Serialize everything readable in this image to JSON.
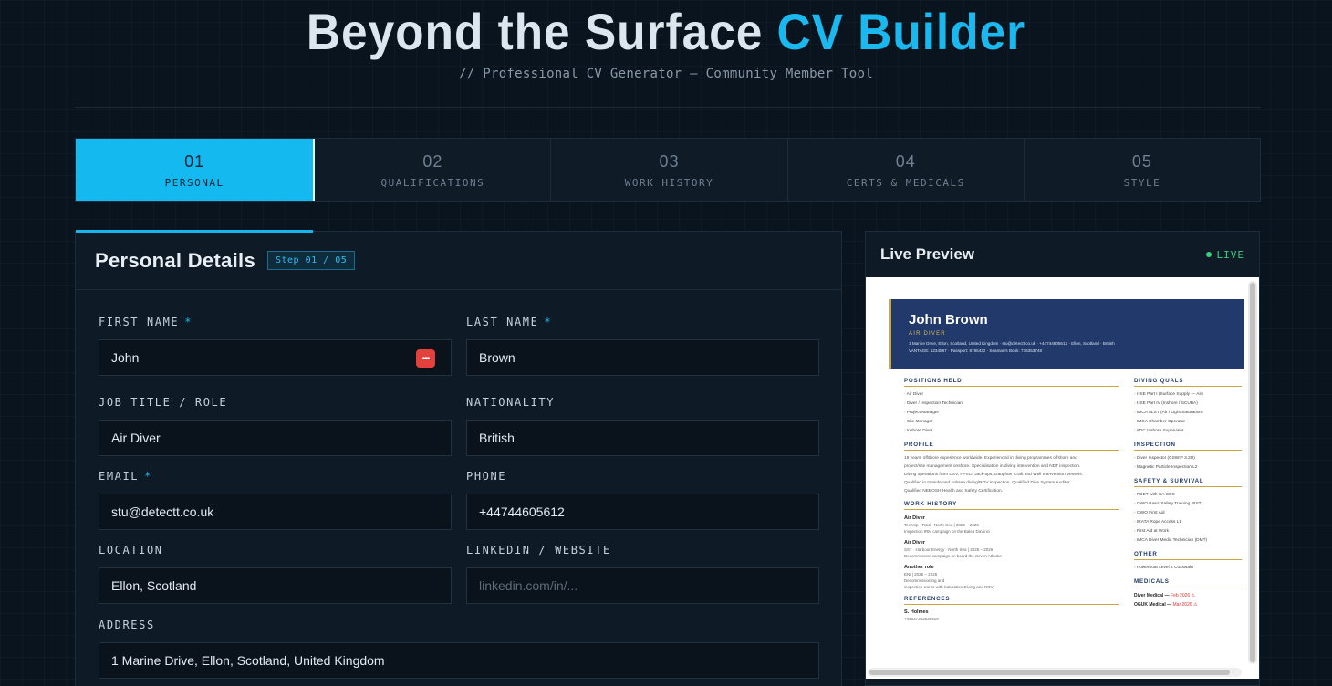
{
  "header": {
    "title_main": "Beyond the Surface ",
    "title_accent": "CV Builder",
    "subtitle": "// Professional CV Generator — Community Member Tool"
  },
  "steps": [
    {
      "num": "01",
      "label": "PERSONAL",
      "active": true
    },
    {
      "num": "02",
      "label": "QUALIFICATIONS",
      "active": false
    },
    {
      "num": "03",
      "label": "WORK HISTORY",
      "active": false
    },
    {
      "num": "04",
      "label": "CERTS & MEDICALS",
      "active": false
    },
    {
      "num": "05",
      "label": "STYLE",
      "active": false
    }
  ],
  "panel": {
    "title": "Personal Details",
    "step_badge": "Step 01 / 05",
    "required_mark": "*",
    "fields": {
      "first_name": {
        "label": "FIRST NAME",
        "value": "John"
      },
      "last_name": {
        "label": "LAST NAME",
        "value": "Brown"
      },
      "job_title": {
        "label": "JOB TITLE / ROLE",
        "value": "Air Diver"
      },
      "nationality": {
        "label": "NATIONALITY",
        "value": "British"
      },
      "email": {
        "label": "EMAIL",
        "value": "stu@detectt.co.uk"
      },
      "phone": {
        "label": "PHONE",
        "value": "+44744605612"
      },
      "location": {
        "label": "LOCATION",
        "value": "Ellon, Scotland"
      },
      "linkedin": {
        "label": "LINKEDIN / WEBSITE",
        "value": "",
        "placeholder": "linkedin.com/in/..."
      },
      "address": {
        "label": "ADDRESS",
        "value": "1 Marine Drive, Ellon, Scotland, United Kingdom"
      }
    }
  },
  "preview": {
    "title": "Live Preview",
    "live_label": "LIVE",
    "cv": {
      "name": "John Brown",
      "role": "AIR DIVER",
      "contact_line1": "1 Marine Drive, Ellon, Scotland, United Kingdom · stu@detectt.co.uk · +44744605612 · Ellon, Scotland · British",
      "contact_line2": "VANTAGE: 1234567 · Passport: 8765432 · Seaman's Book: 736353748",
      "positions_heading": "POSITIONS HELD",
      "positions": [
        "Air Diver",
        "Diver / Inspection Technician",
        "Project Manager",
        "Site Manager",
        "Inshore Diver"
      ],
      "profile_heading": "PROFILE",
      "profile_lines": [
        "18 years' offshore experience worldwide. Experienced in diving programmes offshore and",
        "project/site management onshore. Specialisation in diving intervention and NDT inspection.",
        "Diving operations from DSV, FPSO, Jack-ups, Daughter Craft and Well Intervention Vessels.",
        "Qualified in topside and subsea diving/ROV inspection. Qualified Dive System Auditor.",
        "Qualified NEBOSH Health and Safety Certification."
      ],
      "work_heading": "WORK HISTORY",
      "jobs": [
        {
          "title": "Air Diver",
          "meta1": "Technip · Total · North Sea | 2026 – 2026",
          "meta2": "Inspection IRM campaign on the Balea DaVinci"
        },
        {
          "title": "Air Diver",
          "meta1": "SS7 · Harbour Energy · North Sea | 2025 – 2026",
          "meta2": "Decommission campaign on board the Seven Atlantic"
        },
        {
          "title": "Another role",
          "meta1": "ENI | 2025 – 2025",
          "meta2": "Decommissioning and",
          "meta3": "inspection works with Saturation Diving and ROV"
        }
      ],
      "references_heading": "REFERENCES",
      "ref_name": "S. Holmes",
      "ref_phone": "+44537363636929",
      "diving_heading": "DIVING QUALS",
      "diving": [
        "HSE Part I (Surface Supply — Air)",
        "HSE Part IV (Inshore / SCUBA)",
        "IMCA ALST (Air / Light Saturation)",
        "IMCA Chamber Operator",
        "ADC Inshore Supervisor"
      ],
      "inspection_heading": "INSPECTION",
      "inspection": [
        "Diver Inspector (CSWIP 3.2U)",
        "Magnetic Particle Inspection L2"
      ],
      "safety_heading": "SAFETY & SURVIVAL",
      "safety": [
        "FOET with CA-EBS",
        "GWO Basic Safety Training (BST)",
        "GWO First Aid",
        "IRATA Rope Access L1",
        "First Aid at Work",
        "IMCA Diver Medic Technician (DMT)"
      ],
      "other_heading": "OTHER",
      "other": [
        "Powerboat Level 2 Coxswain"
      ],
      "medicals_heading": "MEDICALS",
      "medicals": [
        {
          "name": "Diver Medical",
          "sep": " — ",
          "exp": "Feb 2026 ⚠"
        },
        {
          "name": "OGUK Medical",
          "sep": " — ",
          "exp": "Mar 2026 ⚠"
        }
      ]
    }
  },
  "colors": {
    "accent": "#1ab8ee",
    "live": "#38d07a",
    "cv_header": "#213a6b",
    "cv_gold": "#c9a544"
  }
}
